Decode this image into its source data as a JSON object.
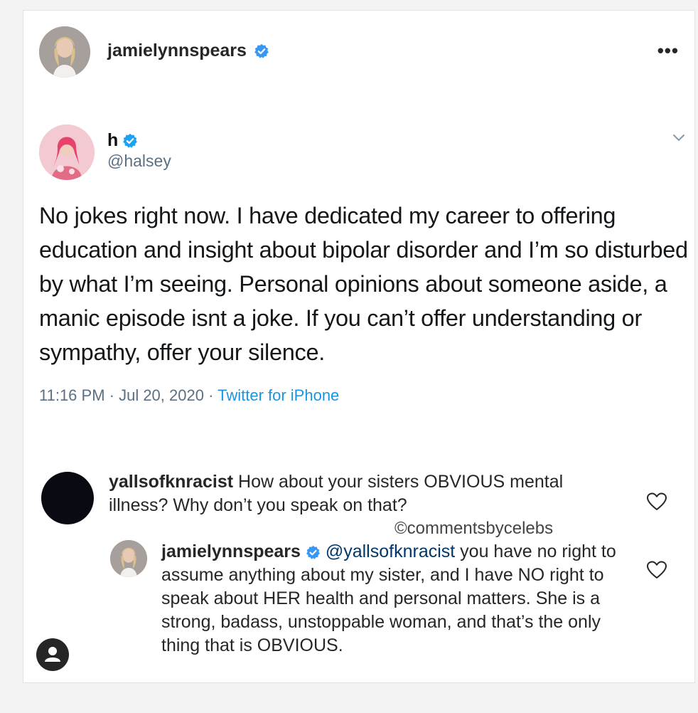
{
  "post": {
    "username": "jamielynnspears",
    "more_label": "•••"
  },
  "tweet": {
    "name": "h",
    "handle": "@halsey",
    "text": "No jokes right now. I have dedicated my career to offering education and insight about bipolar disorder and I’m so disturbed by what I’m seeing. Personal opinions about someone aside, a manic episode isnt a joke. If you can’t offer understanding or sympathy, offer your silence.",
    "time": "11:16 PM · Jul 20, 2020 · ",
    "source": "Twitter for iPhone"
  },
  "comments": [
    {
      "username": "yallsofknracist",
      "text": "How about your sisters OBVIOUS mental illness? Why don’t you speak on that?"
    },
    {
      "username": "jamielynnspears",
      "mention": "@yallsofknracist",
      "text": "you have no right to assume anything about my sister, and I have NO right to speak about HER health and personal matters. She is a strong, badass, unstoppable woman, and that’s the only thing that is OBVIOUS."
    }
  ],
  "watermark": "©commentsbycelebs",
  "colors": {
    "verified": "#3897f0",
    "twitter_link": "#1b95e0",
    "mention": "#00376b"
  },
  "icons": [
    "verified-badge-icon",
    "more-options-icon",
    "chevron-down-icon",
    "heart-icon",
    "profile-icon"
  ]
}
